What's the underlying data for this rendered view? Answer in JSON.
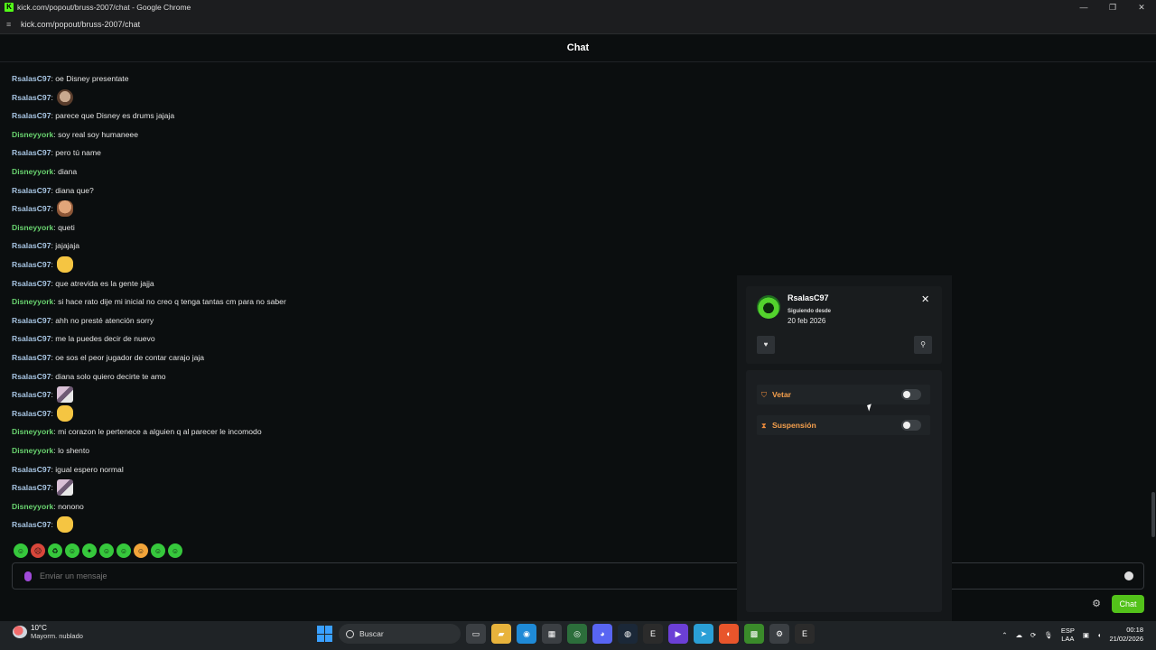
{
  "window": {
    "title": "kick.com/popout/bruss-2007/chat - Google Chrome",
    "url": "kick.com/popout/bruss-2007/chat",
    "controls": [
      "—",
      "❐",
      "✕"
    ]
  },
  "header": {
    "title": "Chat"
  },
  "messages": [
    {
      "user": "RsalasC97",
      "text": ": oe Disney presentate",
      "emote": ""
    },
    {
      "user": "RsalasC97",
      "text": ": ",
      "emote": "cat"
    },
    {
      "user": "RsalasC97",
      "text": ": parece que Disney es drums jajaja",
      "emote": ""
    },
    {
      "user": "Disneyyork",
      "text": ": soy real soy humaneee",
      "emote": ""
    },
    {
      "user": "RsalasC97",
      "text": ": pero tú name",
      "emote": ""
    },
    {
      "user": "Disneyyork",
      "text": ": diana",
      "emote": ""
    },
    {
      "user": "RsalasC97",
      "text": ": diana que?",
      "emote": ""
    },
    {
      "user": "RsalasC97",
      "text": ": ",
      "emote": "face"
    },
    {
      "user": "Disneyyork",
      "text": ": queti",
      "emote": ""
    },
    {
      "user": "RsalasC97",
      "text": ": jajajaja",
      "emote": ""
    },
    {
      "user": "RsalasC97",
      "text": ": ",
      "emote": "yellow"
    },
    {
      "user": "RsalasC97",
      "text": ": que atrevida es la gente jajja",
      "emote": ""
    },
    {
      "user": "Disneyyork",
      "text": ": si hace rato dije mi inicial no creo q tenga tantas cm para no saber",
      "emote": ""
    },
    {
      "user": "RsalasC97",
      "text": ": ahh no presté atención sorry",
      "emote": ""
    },
    {
      "user": "RsalasC97",
      "text": ": me la puedes decir de nuevo",
      "emote": ""
    },
    {
      "user": "RsalasC97",
      "text": ": oe sos el peor jugador de contar carajo jaja",
      "emote": ""
    },
    {
      "user": "RsalasC97",
      "text": ": diana solo quiero decirte te amo",
      "emote": ""
    },
    {
      "user": "RsalasC97",
      "text": ": ",
      "emote": "pink"
    },
    {
      "user": "RsalasC97",
      "text": ": ",
      "emote": "yellow"
    },
    {
      "user": "Disneyyork",
      "text": ": mi corazon le pertenece a alguien q al parecer le incomodo",
      "emote": ""
    },
    {
      "user": "Disneyyork",
      "text": ": lo shento",
      "emote": ""
    },
    {
      "user": "RsalasC97",
      "text": ": igual espero normal",
      "emote": ""
    },
    {
      "user": "RsalasC97",
      "text": ": ",
      "emote": "pink"
    },
    {
      "user": "Disneyyork",
      "text": ": nonono",
      "emote": ""
    },
    {
      "user": "RsalasC97",
      "text": ": ",
      "emote": "yellow"
    }
  ],
  "composer": {
    "placeholder": "Enviar un mensaje",
    "send_label": "Chat"
  },
  "user_card": {
    "username": "RsalasC97",
    "following_since_label": "Siguiendo desde",
    "following_since_date": "20 feb 2026",
    "actions": [
      {
        "label": "Vetar",
        "enabled": false
      },
      {
        "label": "Suspensión",
        "enabled": false
      }
    ]
  },
  "taskbar": {
    "weather_temp": "10°C",
    "weather_desc": "Mayorm. nublado",
    "search_label": "Buscar",
    "lang_top": "ESP",
    "lang_bottom": "LAA",
    "time": "00:18",
    "date": "21/02/2026"
  },
  "colors": {
    "accent": "#53fc18",
    "rsalas_name": "#a8c6e4",
    "disney_name": "#69d36f",
    "action_label": "#f6a04d"
  }
}
